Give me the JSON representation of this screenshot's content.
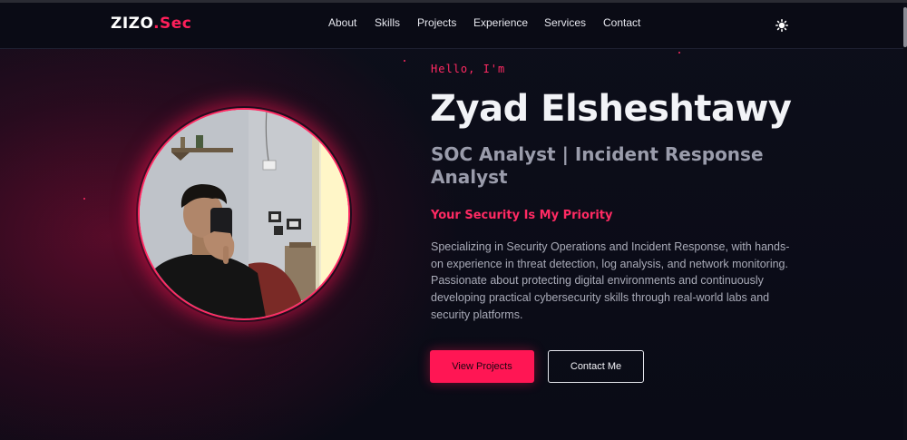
{
  "nav": {
    "logo_main": "ZIZO",
    "logo_accent": ".Sec",
    "links": [
      "About",
      "Skills",
      "Projects",
      "Experience",
      "Services",
      "Contact"
    ],
    "theme_icon": "sun-icon"
  },
  "hero": {
    "greeting": "Hello, I'm",
    "name": "Zyad Elsheshtawy",
    "role": "SOC Analyst | Incident Response Analyst",
    "tagline": "Your Security Is My Priority",
    "description": "Specializing in Security Operations and Incident Response, with hands-on experience in threat detection, log analysis, and network monitoring. Passionate about protecting digital environments and continuously developing practical cybersecurity skills through real-world labs and security platforms.",
    "buttons": {
      "primary": "View Projects",
      "secondary": "Contact Me"
    },
    "photo_icon": "profile-photo"
  },
  "colors": {
    "accent": "#ff1654",
    "background": "#0b0c17",
    "text_muted": "#9a9cab"
  }
}
